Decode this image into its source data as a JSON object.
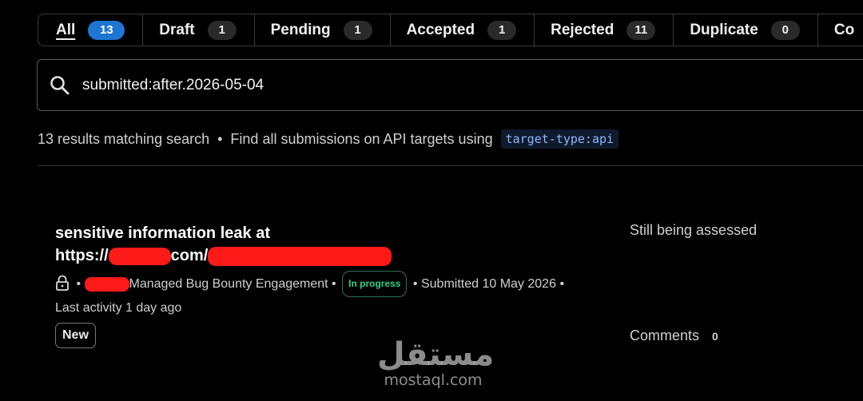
{
  "tabs": [
    {
      "label": "All",
      "count": "13"
    },
    {
      "label": "Draft",
      "count": "1"
    },
    {
      "label": "Pending",
      "count": "1"
    },
    {
      "label": "Accepted",
      "count": "1"
    },
    {
      "label": "Rejected",
      "count": "11"
    },
    {
      "label": "Duplicate",
      "count": "0"
    },
    {
      "label": "Co",
      "count": ""
    }
  ],
  "search": {
    "value": "submitted:after.2026-05-04"
  },
  "results": {
    "summary": "13 results matching search",
    "separator": "•",
    "hint": "Find all submissions on API targets using",
    "hint_code": "target-type:api"
  },
  "submission": {
    "title_prefix": "sensitive information leak at",
    "title_url_a": "https://",
    "title_url_b": "com/",
    "program": "Managed Bug Bounty Engagement",
    "status": "In progress",
    "submitted": "Submitted 10 May 2026",
    "last_activity": "Last activity 1 day ago",
    "tag": "New",
    "state": "Still being assessed",
    "comments_label": "Comments",
    "comments_count": "0"
  },
  "watermark": {
    "logo": "مستقل",
    "text": "mostaql.com"
  },
  "colors": {
    "accent": "#1d76d2",
    "status_green": "#2fd18f",
    "redaction": "#ff1a1a"
  }
}
